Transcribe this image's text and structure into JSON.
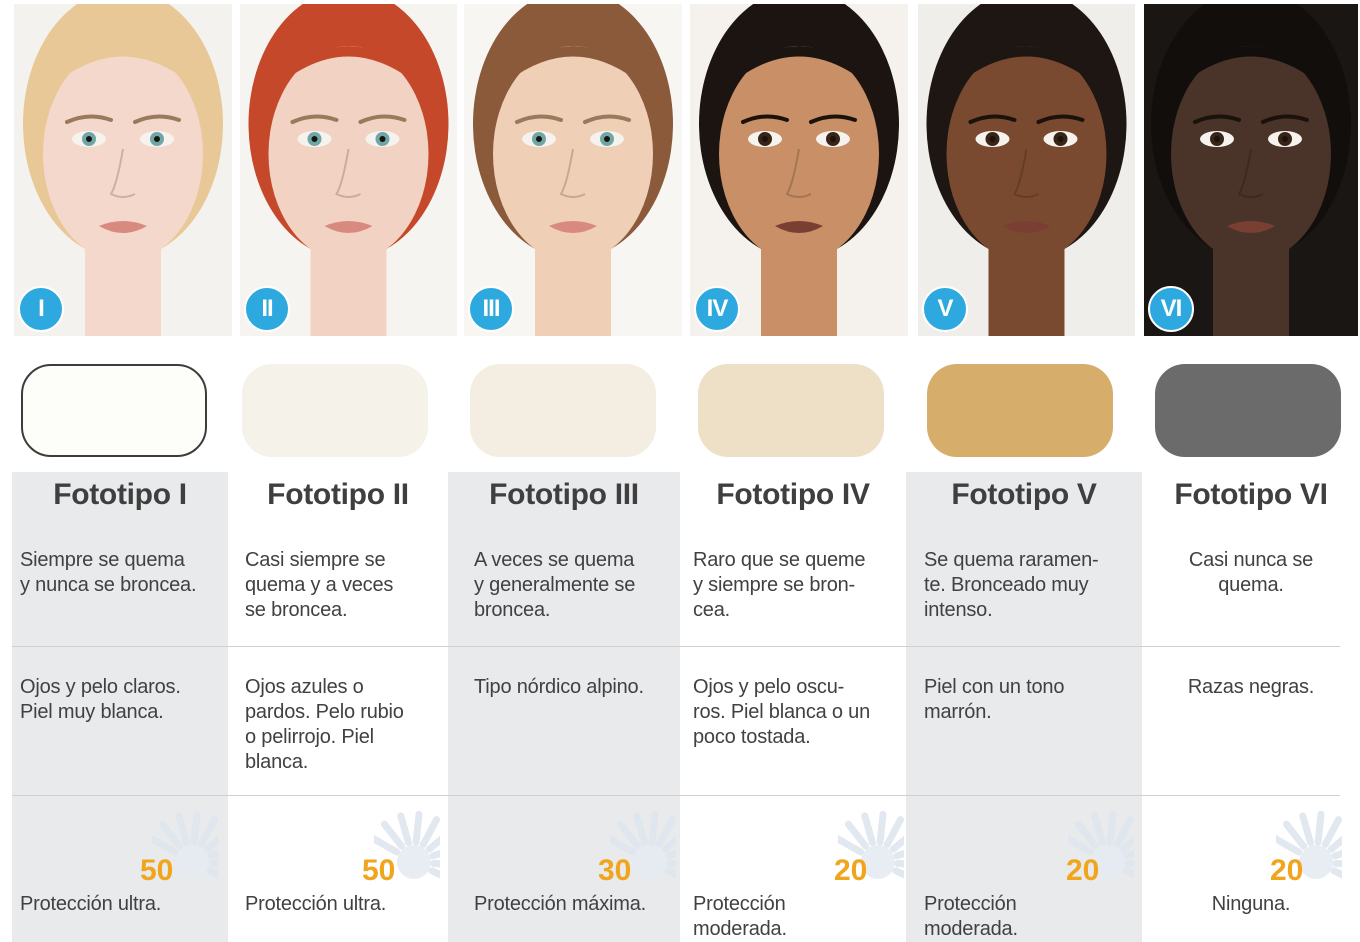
{
  "colors": {
    "badge": "#2ea9e0",
    "spf": "#f0a51c",
    "shaded_column": "#e9eaeb"
  },
  "phototypes": [
    {
      "numeral": "I",
      "title": "Fototipo I",
      "swatch_color": "#fdfdf9",
      "swatch_border": "#3c3c3c",
      "behavior": "Siempre se quema\ny nunca se broncea.",
      "features": "Ojos y pelo claros.\nPiel muy blanca.",
      "spf": "50",
      "protection": "Protección ultra.",
      "skin": "#f4d8cc",
      "hair": "#e8c896",
      "bg": "#f4f2ee"
    },
    {
      "numeral": "II",
      "title": "Fototipo II",
      "swatch_color": "#f5f2e9",
      "swatch_border": "",
      "behavior": "Casi siempre se\nquema y a veces\nse broncea.",
      "features": "Ojos azules o\npardos. Pelo rubio\no pelirrojo. Piel\nblanca.",
      "spf": "50",
      "protection": "Protección ultra.",
      "skin": "#f2d3c3",
      "hair": "#c5482a",
      "bg": "#f6f4f1"
    },
    {
      "numeral": "III",
      "title": "Fototipo III",
      "swatch_color": "#f4ede2",
      "swatch_border": "",
      "behavior": "A veces se quema\ny generalmente se\nbroncea.",
      "features": "Tipo nórdico alpino.",
      "spf": "30",
      "protection": "Protección máxima.",
      "skin": "#efcfb6",
      "hair": "#8a5a3a",
      "bg": "#f8f6f3"
    },
    {
      "numeral": "IV",
      "title": "Fototipo IV",
      "swatch_color": "#eedfc7",
      "swatch_border": "",
      "behavior": "Raro que se queme\ny siempre se bron-\ncea.",
      "features": "Ojos y pelo oscu-\nros. Piel blanca o un\npoco tostada.",
      "spf": "20",
      "protection": "Protección\nmoderada.",
      "skin": "#c98f66",
      "hair": "#1b1411",
      "bg": "#f5f1ec"
    },
    {
      "numeral": "V",
      "title": "Fototipo V",
      "swatch_color": "#d7ad6b",
      "swatch_border": "",
      "behavior": "Se quema raramen-\nte. Bronceado muy\nintenso.",
      "features": "Piel con un tono\nmarrón.",
      "spf": "20",
      "protection": "Protección\nmoderada.",
      "skin": "#7a4a30",
      "hair": "#1e1612",
      "bg": "#f0eeea"
    },
    {
      "numeral": "VI",
      "title": "Fototipo VI",
      "swatch_color": "#6b6b6b",
      "swatch_border": "",
      "behavior": "Casi nunca se\nquema.",
      "features": "Razas negras.",
      "spf": "20",
      "protection": "Ninguna.",
      "skin": "#4a3328",
      "hair": "#120e0c",
      "bg": "#1a1614"
    }
  ]
}
